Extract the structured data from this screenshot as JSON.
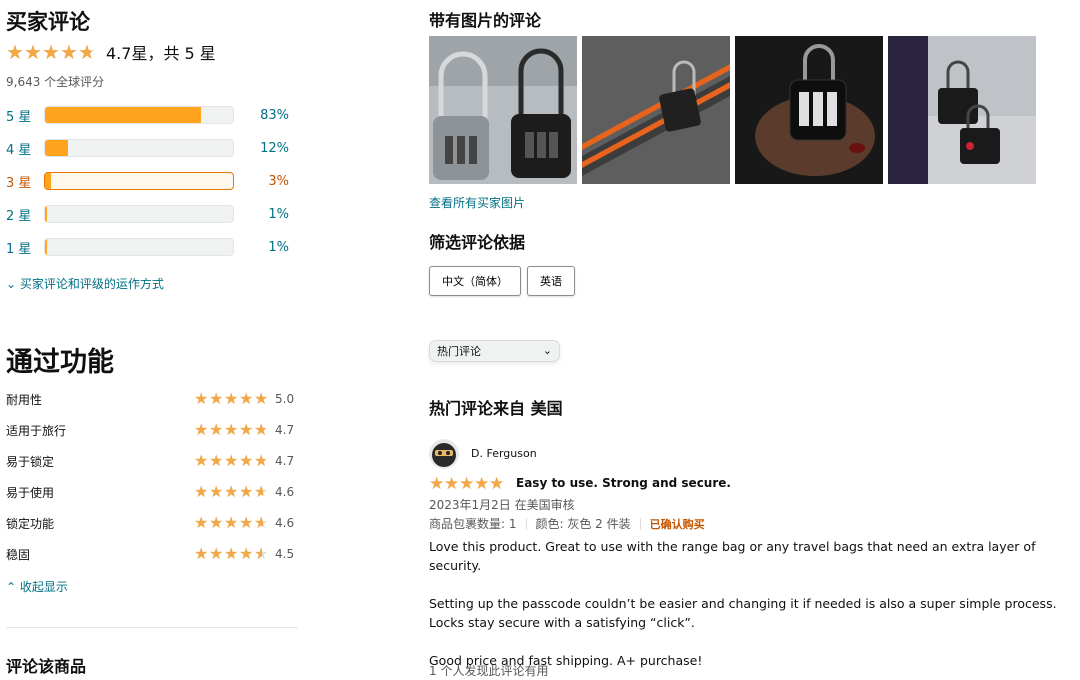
{
  "reviews_summary": {
    "heading": "买家评论",
    "average_stars": 4.7,
    "average_text": "4.7星，共 5 星",
    "global_count": "9,643 个全球评分",
    "histogram": [
      {
        "label": "5 星",
        "percent_text": "83%",
        "percent": 83
      },
      {
        "label": "4 星",
        "percent_text": "12%",
        "percent": 12
      },
      {
        "label": "3 星",
        "percent_text": "3%",
        "percent": 3
      },
      {
        "label": "2 星",
        "percent_text": "1%",
        "percent": 1
      },
      {
        "label": "1 星",
        "percent_text": "1%",
        "percent": 1
      }
    ],
    "how_it_works": "买家评论和评级的运作方式"
  },
  "features": {
    "heading": "通过功能",
    "items": [
      {
        "name": "耐用性",
        "score": "5.0",
        "rating": 5.0
      },
      {
        "name": "适用于旅行",
        "score": "4.7",
        "rating": 4.7
      },
      {
        "name": "易于锁定",
        "score": "4.7",
        "rating": 4.7
      },
      {
        "name": "易于使用",
        "score": "4.6",
        "rating": 4.6
      },
      {
        "name": "锁定功能",
        "score": "4.6",
        "rating": 4.6
      },
      {
        "name": "稳固",
        "score": "4.5",
        "rating": 4.5
      }
    ],
    "collapse_label": "收起显示"
  },
  "review_this_item": "评论该商品",
  "photos": {
    "heading": "带有图片的评论",
    "see_all": "查看所有买家图片"
  },
  "filter": {
    "heading": "筛选评论依据",
    "buttons": [
      "中文（简体）",
      "英语"
    ]
  },
  "sort": {
    "selected": "热门评论"
  },
  "top_reviews_heading": "热门评论来自 美国",
  "review": {
    "reviewer": "D. Ferguson",
    "rating": 5,
    "title": "Easy to use. Strong and secure.",
    "date": "2023年1月2日 在美国审核",
    "pack_qty": "商品包裹数量: 1",
    "color": "颜色: 灰色 2 件装",
    "verified": "已确认购买",
    "body": [
      "Love this product. Great to use with the range bag or any travel bags that need an extra layer of security.",
      "Setting up the passcode couldn’t be easier and changing it if needed is also a super simple process. Locks stay secure with a satisfying “click”.",
      "Good price and fast shipping. A+ purchase!"
    ],
    "helpful": "1 个人发现此评论有用"
  },
  "colors": {
    "star": "#f3a847",
    "bar": "#ffa41c",
    "link": "#007185",
    "highlight": "#c45500"
  }
}
